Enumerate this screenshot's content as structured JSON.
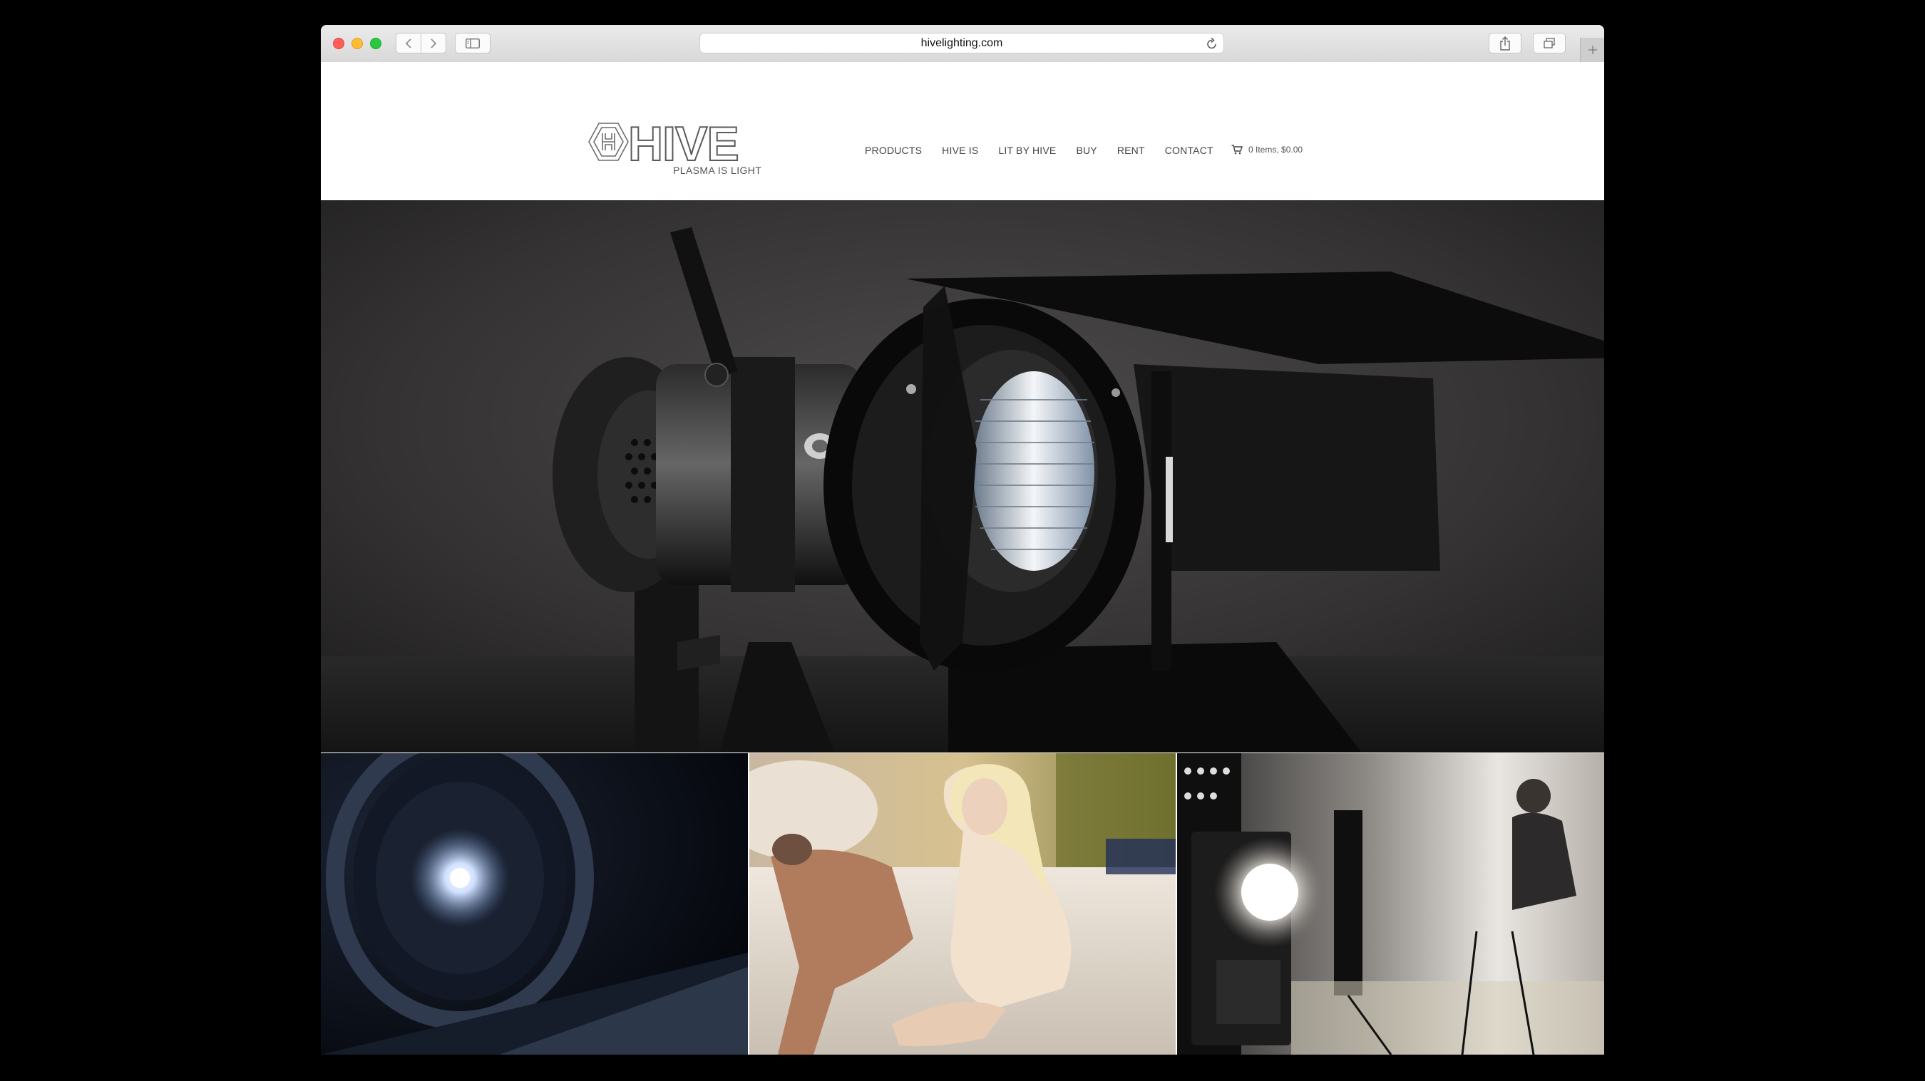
{
  "browser": {
    "url": "hivelighting.com",
    "icons": [
      "back-icon",
      "forward-icon",
      "sidebar-icon",
      "reload-icon",
      "share-icon",
      "tabs-icon",
      "new-tab-icon"
    ]
  },
  "site": {
    "logo_text": "HIVE",
    "tagline": "PLASMA IS LIGHT",
    "nav": [
      {
        "label": "PRODUCTS"
      },
      {
        "label": "HIVE IS"
      },
      {
        "label": "LIT BY HIVE"
      },
      {
        "label": "BUY"
      },
      {
        "label": "RENT"
      },
      {
        "label": "CONTACT"
      }
    ],
    "cart": {
      "label": "0 Items, $0.00",
      "icon": "cart-icon"
    }
  },
  "colors": {
    "traffic_red": "#fe5f57",
    "traffic_yellow": "#febc2e",
    "traffic_green": "#28c840"
  }
}
